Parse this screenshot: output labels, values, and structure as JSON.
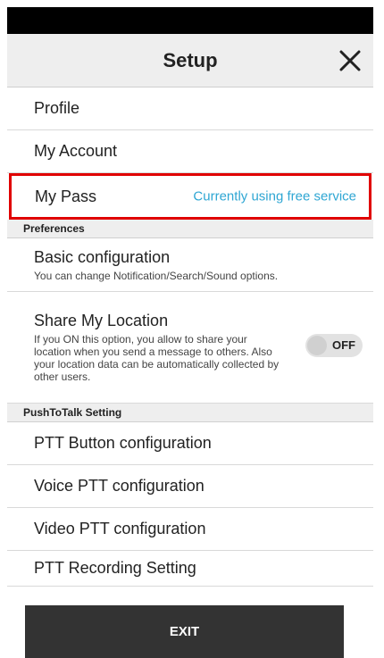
{
  "header": {
    "title": "Setup",
    "close_icon": "close-x-icon"
  },
  "items_top": [
    {
      "label": "Profile"
    },
    {
      "label": "My Account"
    }
  ],
  "my_pass": {
    "label": "My Pass",
    "status": "Currently using free service",
    "status_color": "#2ea6d3",
    "highlight_color": "#e00000"
  },
  "preferences": {
    "header": "Preferences",
    "basic": {
      "label": "Basic configuration",
      "desc": "You can change Notification/Search/Sound options."
    },
    "share": {
      "label": "Share My Location",
      "desc": "If you ON this option, you allow to share your location when you send a message to others. Also your location data can be automatically collected by other users.",
      "toggle": "OFF"
    }
  },
  "ptt": {
    "header": "PushToTalk Setting",
    "items": [
      {
        "label": "PTT Button configuration"
      },
      {
        "label": "Voice PTT configuration"
      },
      {
        "label": "Video PTT configuration"
      },
      {
        "label": "PTT Recording Setting"
      }
    ]
  },
  "exit_label": "EXIT"
}
